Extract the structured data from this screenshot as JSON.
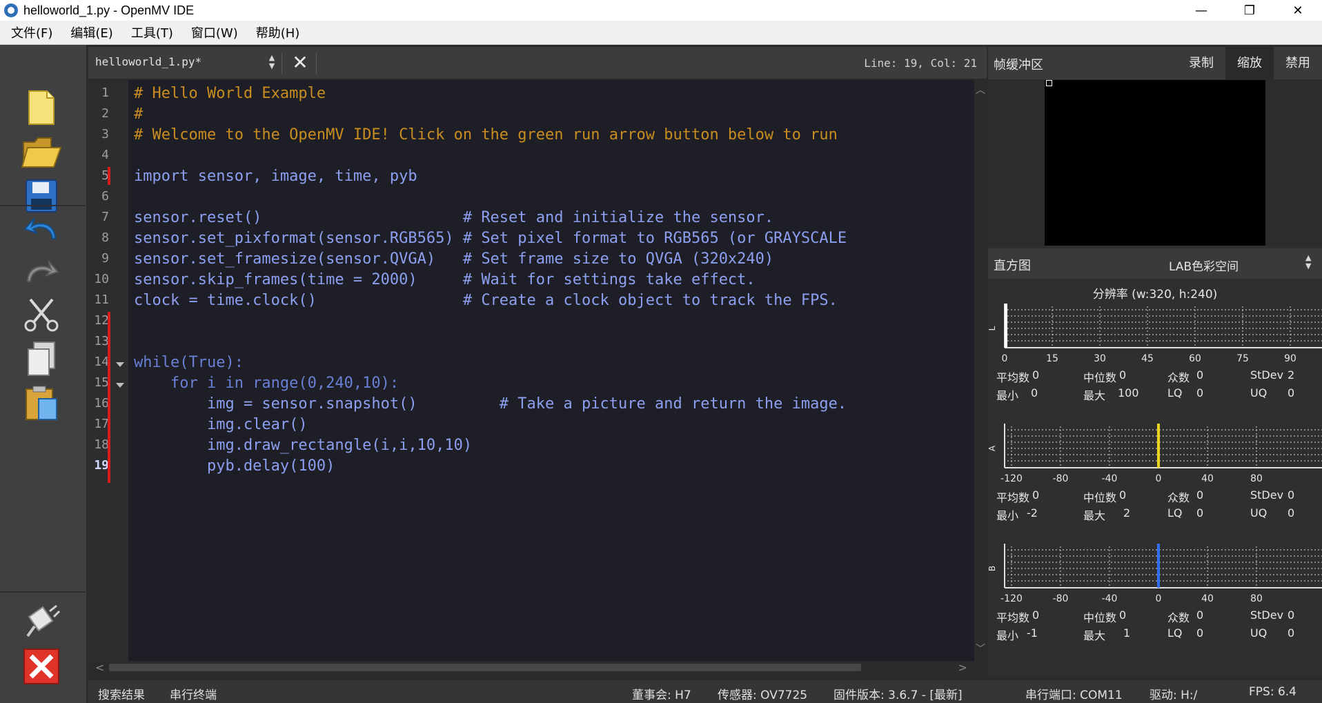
{
  "window": {
    "title": "helloworld_1.py - OpenMV IDE",
    "minimize": "—",
    "restore": "❐",
    "close": "✕"
  },
  "menu": [
    "文件(F)",
    "编辑(E)",
    "工具(T)",
    "窗口(W)",
    "帮助(H)"
  ],
  "toolbar": {
    "icons": [
      "new-file-icon",
      "open-folder-icon",
      "save-icon",
      "undo-icon",
      "redo-icon",
      "cut-icon",
      "copy-icon",
      "paste-icon",
      "connect-icon",
      "stop-icon"
    ]
  },
  "editor": {
    "tab": "helloworld_1.py*",
    "position": "Line: 19, Col: 21",
    "line_numbers": [
      "1",
      "2",
      "3",
      "4",
      "5",
      "6",
      "7",
      "8",
      "9",
      "10",
      "11",
      "12",
      "13",
      "14",
      "15",
      "16",
      "17",
      "18",
      "19"
    ],
    "lines": [
      "# Hello World Example",
      "#",
      "# Welcome to the OpenMV IDE! Click on the green run arrow button below to run",
      "",
      "import sensor, image, time, pyb",
      "",
      "sensor.reset()                      # Reset and initialize the sensor.",
      "sensor.set_pixformat(sensor.RGB565) # Set pixel format to RGB565 (or GRAYSCALE",
      "sensor.set_framesize(sensor.QVGA)   # Set frame size to QVGA (320x240)",
      "sensor.skip_frames(time = 2000)     # Wait for settings take effect.",
      "clock = time.clock()                # Create a clock object to track the FPS.",
      "",
      "",
      "while(True):",
      "    for i in range(0,240,10):",
      "        img = sensor.snapshot()         # Take a picture and return the image.",
      "        img.clear()",
      "        img.draw_rectangle(i,i,10,10)",
      "        pyb.delay(100)"
    ]
  },
  "frame_buffer": {
    "title": "帧缓冲区",
    "record": "录制",
    "zoom": "缩放",
    "disable": "禁用"
  },
  "histogram": {
    "title": "直方图",
    "mode": "LAB色彩空间",
    "resolution": "分辨率 (w:320, h:240)",
    "channels": [
      {
        "label": "L",
        "ticks": [
          "0",
          "15",
          "30",
          "45",
          "60",
          "75",
          "90"
        ],
        "marker_color": "#ffffff",
        "marker_value": 0,
        "range": [
          0,
          100
        ],
        "stats": {
          "mean_label": "平均数",
          "mean": "0",
          "median_label": "中位数",
          "median": "0",
          "mode_label": "众数",
          "mode": "0",
          "stdev_label": "StDev",
          "stdev": "2",
          "min_label": "最小",
          "min": "0",
          "max_label": "最大",
          "max": "100",
          "lq_label": "LQ",
          "lq": "0",
          "uq_label": "UQ",
          "uq": "0"
        }
      },
      {
        "label": "A",
        "ticks": [
          "-120",
          "-80",
          "-40",
          "0",
          "40",
          "80"
        ],
        "marker_color": "#e8d51e",
        "marker_value": 0,
        "range": [
          -128,
          127
        ],
        "stats": {
          "mean_label": "平均数",
          "mean": "0",
          "median_label": "中位数",
          "median": "0",
          "mode_label": "众数",
          "mode": "0",
          "stdev_label": "StDev",
          "stdev": "0",
          "min_label": "最小",
          "min": "-2",
          "max_label": "最大",
          "max": "2",
          "lq_label": "LQ",
          "lq": "0",
          "uq_label": "UQ",
          "uq": "0"
        }
      },
      {
        "label": "B",
        "ticks": [
          "-120",
          "-80",
          "-40",
          "0",
          "40",
          "80"
        ],
        "marker_color": "#2f6ff0",
        "marker_value": 0,
        "range": [
          -128,
          127
        ],
        "stats": {
          "mean_label": "平均数",
          "mean": "0",
          "median_label": "中位数",
          "median": "0",
          "mode_label": "众数",
          "mode": "0",
          "stdev_label": "StDev",
          "stdev": "0",
          "min_label": "最小",
          "min": "-1",
          "max_label": "最大",
          "max": "1",
          "lq_label": "LQ",
          "lq": "0",
          "uq_label": "UQ",
          "uq": "0"
        }
      }
    ]
  },
  "status": {
    "search_results": "搜索结果",
    "serial_terminal": "串行终端",
    "board": "董事会: H7",
    "sensor": "传感器: OV7725",
    "firmware": "固件版本: 3.6.7 - [最新]",
    "serial_port": "串行端口: COM11",
    "drive": "驱动: H:/",
    "fps": "FPS:  6.4"
  }
}
